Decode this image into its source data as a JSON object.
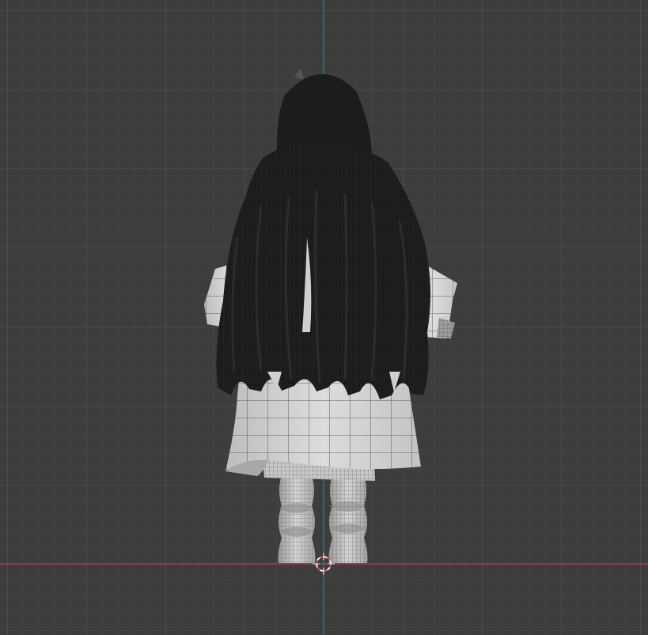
{
  "viewport": {
    "view": "back-orthographic",
    "object": "character-model",
    "display_mode": "solid-wireframe",
    "colors": {
      "background": "#3d3d3d",
      "grid_minor": "#474747",
      "grid_major": "#555555",
      "axis_x": "#b9444b",
      "axis_z": "#3f6eb5",
      "hair": "#1c1c1c",
      "cloth": "#d2d2d2",
      "wire": "#3a3a3a",
      "cursor_red": "#d84a4a",
      "cursor_white": "#f2f2f2"
    },
    "icons": [
      "3d-cursor-icon"
    ]
  }
}
